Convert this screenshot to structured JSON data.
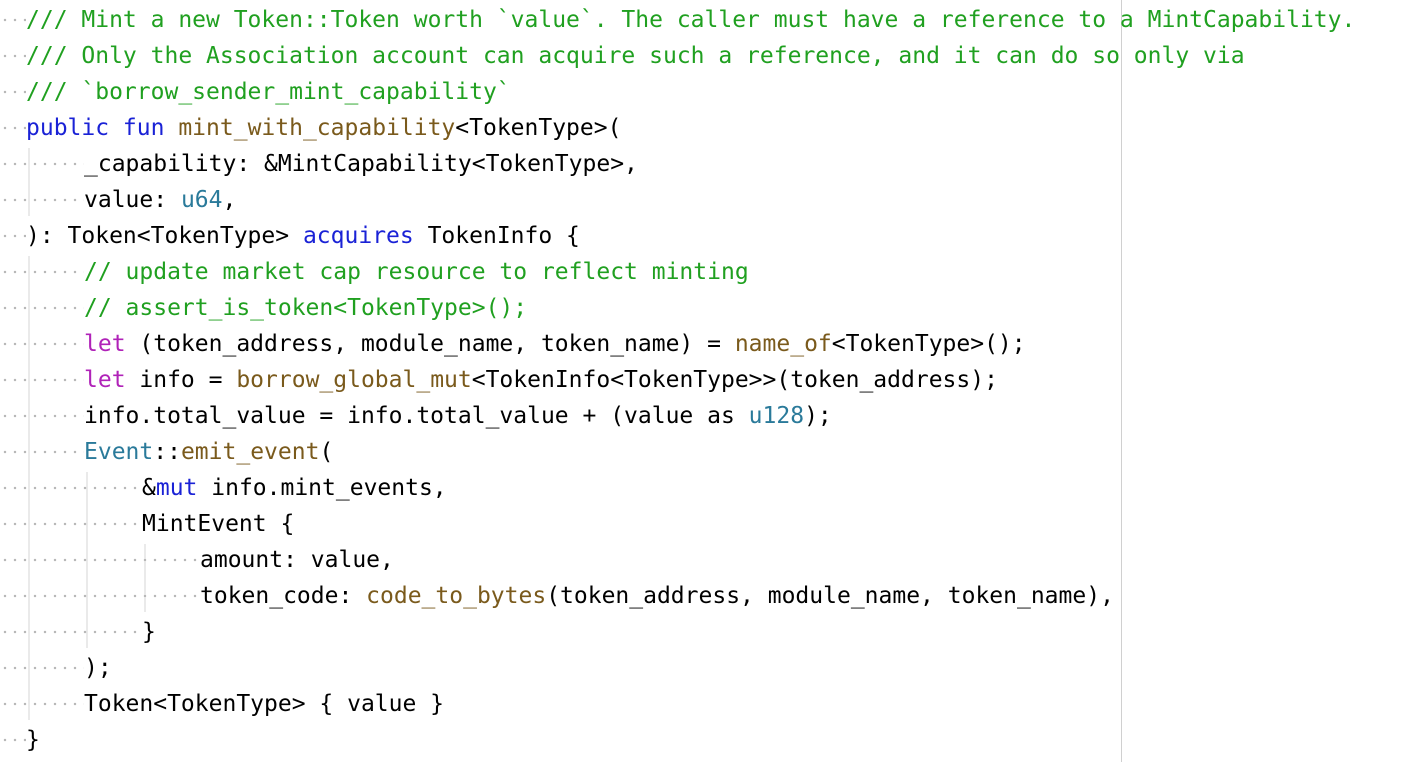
{
  "colors": {
    "background": "#ffffff",
    "comment": "#20a020",
    "keyword": "#1a22d6",
    "keyword_purple": "#b022b8",
    "function": "#7a5a1c",
    "type": "#2a7a9a",
    "plain": "#000000",
    "ruler": "#d0d0d0"
  },
  "lines": [
    {
      "indent": 1,
      "tokens": [
        {
          "t": "/// Mint a new Token::Token worth `value`. The caller must have a reference to a MintCapability.",
          "c": "c"
        }
      ]
    },
    {
      "indent": 1,
      "tokens": [
        {
          "t": "/// Only the Association account can acquire such a reference, and it can do so only via",
          "c": "c"
        }
      ]
    },
    {
      "indent": 1,
      "tokens": [
        {
          "t": "/// `borrow_sender_mint_capability`",
          "c": "c"
        }
      ]
    },
    {
      "indent": 1,
      "tokens": [
        {
          "t": "public fun ",
          "c": "k"
        },
        {
          "t": "mint_with_capability",
          "c": "f"
        },
        {
          "t": "<TokenType>(",
          "c": ""
        }
      ]
    },
    {
      "indent": 4,
      "tokens": [
        {
          "t": "_capability: &MintCapability<TokenType>,",
          "c": ""
        }
      ]
    },
    {
      "indent": 4,
      "tokens": [
        {
          "t": "value: ",
          "c": ""
        },
        {
          "t": "u64",
          "c": "t"
        },
        {
          "t": ",",
          "c": ""
        }
      ]
    },
    {
      "indent": 1,
      "tokens": [
        {
          "t": "): Token<TokenType> ",
          "c": ""
        },
        {
          "t": "acquires",
          "c": "k"
        },
        {
          "t": " TokenInfo {",
          "c": ""
        }
      ]
    },
    {
      "indent": 4,
      "tokens": [
        {
          "t": "// update market cap resource to reflect minting",
          "c": "c"
        }
      ]
    },
    {
      "indent": 4,
      "tokens": [
        {
          "t": "// assert_is_token<TokenType>();",
          "c": "c"
        }
      ]
    },
    {
      "indent": 4,
      "tokens": [
        {
          "t": "let",
          "c": "p"
        },
        {
          "t": " (token_address, module_name, token_name) = ",
          "c": ""
        },
        {
          "t": "name_of",
          "c": "f"
        },
        {
          "t": "<TokenType>();",
          "c": ""
        }
      ]
    },
    {
      "indent": 4,
      "tokens": [
        {
          "t": "let",
          "c": "p"
        },
        {
          "t": " info = ",
          "c": ""
        },
        {
          "t": "borrow_global_mut",
          "c": "f"
        },
        {
          "t": "<TokenInfo<TokenType>>(token_address);",
          "c": ""
        }
      ]
    },
    {
      "indent": 4,
      "tokens": [
        {
          "t": "info.total_value = info.total_value + (value as ",
          "c": ""
        },
        {
          "t": "u128",
          "c": "t"
        },
        {
          "t": ");",
          "c": ""
        }
      ]
    },
    {
      "indent": 4,
      "tokens": [
        {
          "t": "Event",
          "c": "t"
        },
        {
          "t": "::",
          "c": ""
        },
        {
          "t": "emit_event",
          "c": "f"
        },
        {
          "t": "(",
          "c": ""
        }
      ]
    },
    {
      "indent": 8,
      "tokens": [
        {
          "t": "&",
          "c": ""
        },
        {
          "t": "mut",
          "c": "k"
        },
        {
          "t": " info.mint_events,",
          "c": ""
        }
      ]
    },
    {
      "indent": 8,
      "tokens": [
        {
          "t": "MintEvent {",
          "c": ""
        }
      ]
    },
    {
      "indent": 12,
      "tokens": [
        {
          "t": "amount: value,",
          "c": ""
        }
      ]
    },
    {
      "indent": 12,
      "tokens": [
        {
          "t": "token_code: ",
          "c": ""
        },
        {
          "t": "code_to_bytes",
          "c": "f"
        },
        {
          "t": "(token_address, module_name, token_name),",
          "c": ""
        }
      ]
    },
    {
      "indent": 8,
      "tokens": [
        {
          "t": "}",
          "c": ""
        }
      ]
    },
    {
      "indent": 4,
      "tokens": [
        {
          "t": ");",
          "c": ""
        }
      ]
    },
    {
      "indent": 4,
      "tokens": [
        {
          "t": "Token<TokenType> { value }",
          "c": ""
        }
      ]
    },
    {
      "indent": 1,
      "tokens": [
        {
          "t": "}",
          "c": ""
        }
      ]
    }
  ]
}
